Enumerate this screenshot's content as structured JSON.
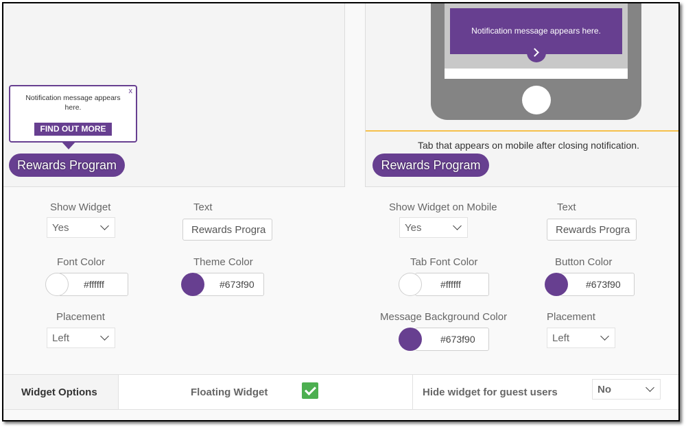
{
  "colors": {
    "theme": "#673f90",
    "accent_orange": "#f5c04a",
    "check_green": "#4caf50"
  },
  "preview_left": {
    "popup_message": "Notification message appears here.",
    "popup_close": "x",
    "popup_button": "FIND OUT MORE",
    "tab_label": "Rewards Program"
  },
  "preview_right": {
    "phone_message": "Notification message appears here.",
    "caption": "Tab that appears on mobile after closing notification.",
    "tab_label": "Rewards Program"
  },
  "desktop_settings": {
    "show_widget_label": "Show Widget",
    "show_widget_value": "Yes",
    "text_label": "Text",
    "text_value": "Rewards Progra",
    "font_color_label": "Font Color",
    "font_color_value": "#ffffff",
    "theme_color_label": "Theme Color",
    "theme_color_value": "#673f90",
    "placement_label": "Placement",
    "placement_value": "Left"
  },
  "mobile_settings": {
    "show_widget_label": "Show Widget on Mobile",
    "show_widget_value": "Yes",
    "text_label": "Text",
    "text_value": "Rewards Progra",
    "tab_font_color_label": "Tab Font Color",
    "tab_font_color_value": "#ffffff",
    "button_color_label": "Button Color",
    "button_color_value": "#673f90",
    "message_bg_label": "Message Background Color",
    "message_bg_value": "#673f90",
    "placement_label": "Placement",
    "placement_value": "Left"
  },
  "bottom_bar": {
    "widget_options": "Widget Options",
    "floating_widget": "Floating Widget",
    "floating_checked": true,
    "hide_guest_label": "Hide widget for guest users",
    "hide_guest_value": "No"
  }
}
